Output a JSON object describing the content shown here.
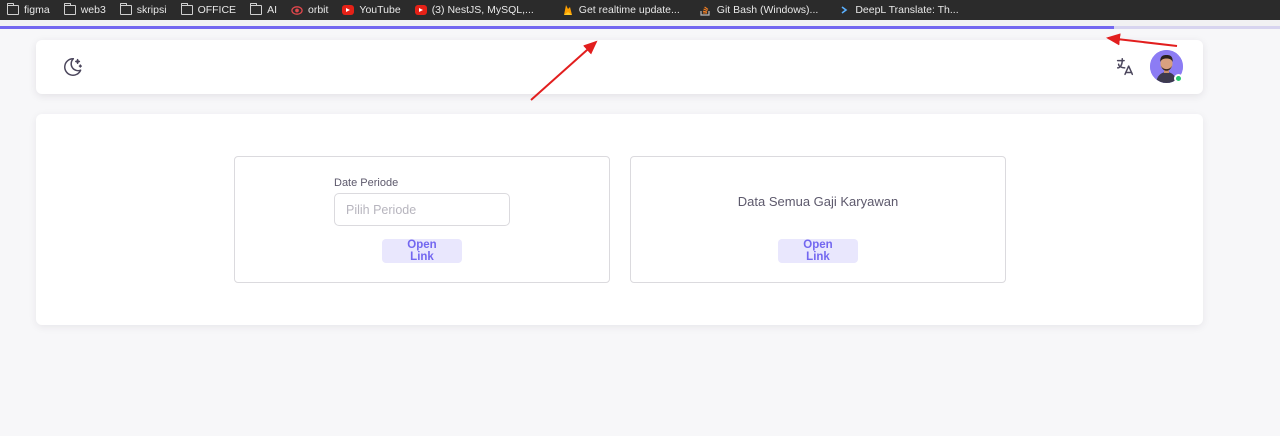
{
  "bookmarks": [
    {
      "label": "figma",
      "icon": "folder-icon"
    },
    {
      "label": "web3",
      "icon": "folder-icon"
    },
    {
      "label": "skripsi",
      "icon": "folder-icon"
    },
    {
      "label": "OFFICE",
      "icon": "folder-icon"
    },
    {
      "label": "AI",
      "icon": "folder-icon"
    },
    {
      "label": "orbit",
      "icon": "orbit-icon"
    },
    {
      "label": "YouTube",
      "icon": "youtube-icon"
    },
    {
      "label": "(3) NestJS, MySQL,...",
      "icon": "youtube-icon"
    },
    {
      "label": "Get realtime update...",
      "icon": "firebase-icon"
    },
    {
      "label": "Git Bash (Windows)...",
      "icon": "stackoverflow-icon"
    },
    {
      "label": "DeepL Translate: Th...",
      "icon": "deepl-icon"
    }
  ],
  "page_loading_progress": 0.87,
  "navbar": {
    "theme_toggle_icon": "moon-icon",
    "translate_icon": "translate-icon",
    "avatar_status": "online"
  },
  "period_panel": {
    "label": "Date Periode",
    "input_placeholder": "Pilih Periode",
    "input_value": "",
    "button_label": "Open Link"
  },
  "salary_panel": {
    "title": "Data Semua Gaji Karyawan",
    "button_label": "Open Link"
  },
  "colors": {
    "primary": "#7367f0",
    "button_bg": "#e9e7fd",
    "status_online": "#28c76f",
    "annotation_arrow": "#e21e1e"
  }
}
